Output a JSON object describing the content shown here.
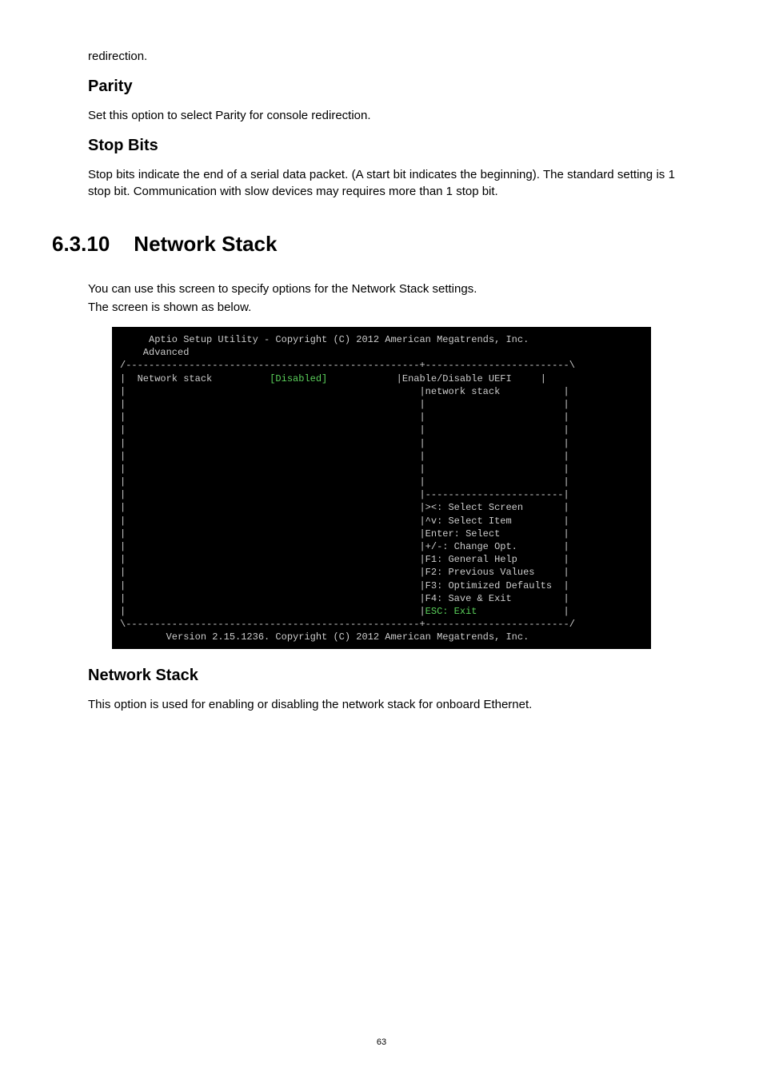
{
  "intro_trail": "redirection.",
  "parity": {
    "heading": "Parity",
    "body": "Set this option to select Parity for console redirection."
  },
  "stopbits": {
    "heading": "Stop Bits",
    "body": "Stop bits indicate the end of a serial data packet. (A start bit indicates the beginning). The standard setting is 1 stop bit. Communication with slow devices may requires more than 1 stop bit."
  },
  "h2": {
    "num": "6.3.10",
    "title": "Network Stack"
  },
  "ns_intro_l1": "You can use this screen to specify options for the Network Stack settings.",
  "ns_intro_l2": "The screen is shown as below.",
  "bios": {
    "title": "     Aptio Setup Utility - Copyright (C) 2012 American Megatrends, Inc.",
    "tab": "    Advanced",
    "top_hr": "/---------------------------------------------------+-------------------------\\",
    "row_label": "|  Network stack",
    "row_value": "          [Disabled]",
    "row_help1": "            |Enable/Disable UEFI     |",
    "row_help2": "|                                                   |network stack           |",
    "blank_row": "|                                                   |                        |",
    "mid_hr": "|                                                   |------------------------|",
    "help_select_screen": "|                                                   |><: Select Screen       |",
    "help_select_item": "|                                                   |^v: Select Item         |",
    "help_enter": "|                                                   |Enter: Select           |",
    "help_change": "|                                                   |+/-: Change Opt.        |",
    "help_f1": "|                                                   |F1: General Help        |",
    "help_f2": "|                                                   |F2: Previous Values     |",
    "help_f3": "|                                                   |F3: Optimized Defaults  |",
    "help_f4": "|                                                   |F4: Save & Exit         |",
    "help_esc_pre": "|                                                   |",
    "help_esc": "ESC: Exit",
    "help_esc_post": "               |",
    "bot_hr": "\\---------------------------------------------------+-------------------------/",
    "footer": "        Version 2.15.1236. Copyright (C) 2012 American Megatrends, Inc."
  },
  "ns_sub": {
    "heading": "Network Stack",
    "body": "This option is used for enabling or disabling the network stack for onboard Ethernet."
  },
  "page": "63"
}
